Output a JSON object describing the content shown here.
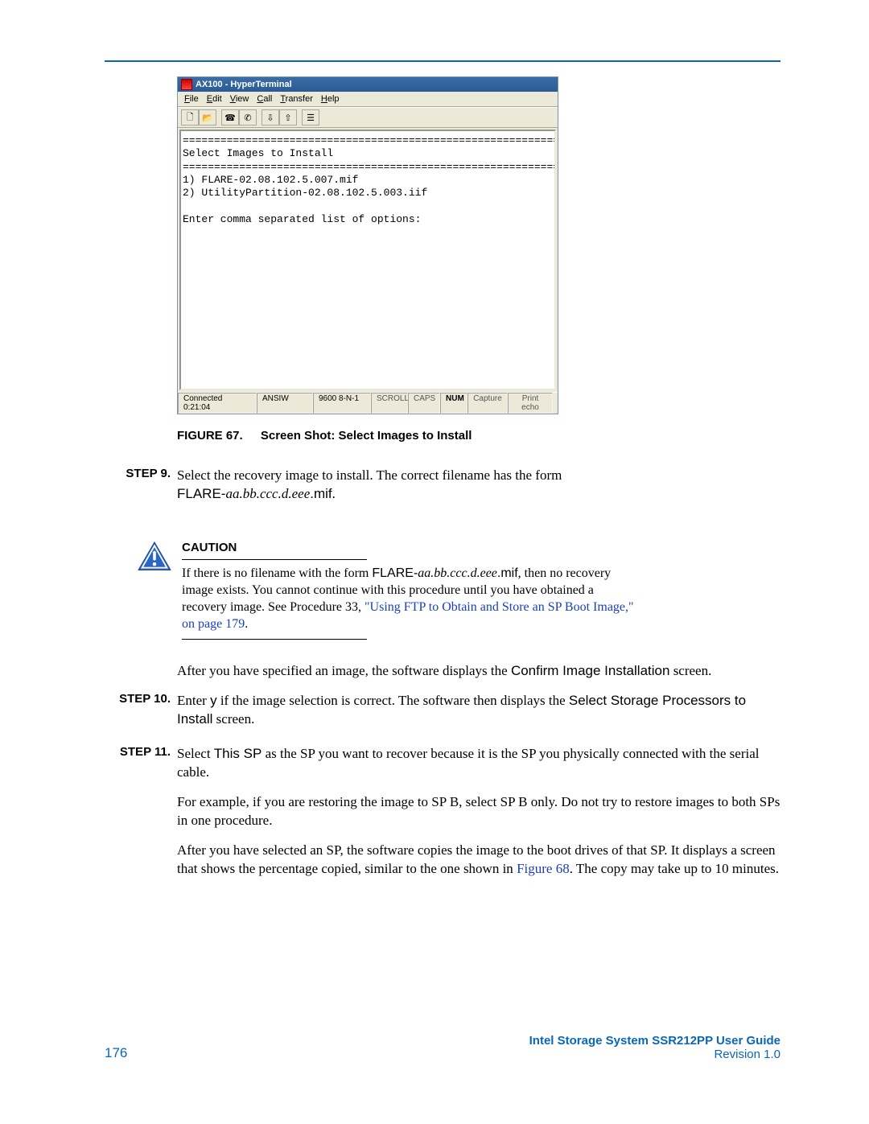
{
  "rule_color": "#0a66b7",
  "hyperterm": {
    "title": "AX100 - HyperTerminal",
    "menu": {
      "file": "File",
      "edit": "Edit",
      "view": "View",
      "call": "Call",
      "transfer": "Transfer",
      "help": "Help"
    },
    "toolbar_icons": [
      "new-file-icon",
      "open-file-icon",
      "connect-icon",
      "disconnect-icon",
      "send-icon",
      "receive-icon",
      "properties-icon"
    ],
    "terminal_text": "=============================================================\nSelect Images to Install\n=============================================================\n1) FLARE-02.08.102.5.007.mif\n2) UtilityPartition-02.08.102.5.003.iif\n\nEnter comma separated list of options:",
    "status": {
      "connected": "Connected 0:21:04",
      "emulation": "ANSIW",
      "port": "9600 8-N-1",
      "scroll": "SCROLL",
      "caps": "CAPS",
      "num": "NUM",
      "capture": "Capture",
      "printecho": "Print echo"
    }
  },
  "figure": {
    "label": "FIGURE 67.",
    "caption": "Screen Shot: Select Images to Install"
  },
  "steps": {
    "s9_label": "STEP 9.",
    "s9_line1": "Select the recovery image to install. The correct filename has the form",
    "s9_flare_prefix": "FLARE-",
    "s9_flare_var": "aa.bb.ccc.d.eee",
    "s9_flare_suffix": ".mif",
    "s9_period": ".",
    "s10_label": "STEP 10.",
    "s10_pre": "Enter ",
    "s10_y": "y",
    "s10_mid": " if the image selection is correct. The software then displays the ",
    "s10_screen": "Select Storage Processors to Install",
    "s10_post": " screen.",
    "s11_label": "STEP 11.",
    "s11_p1a": "Select ",
    "s11_thissp": "This SP",
    "s11_p1b": " as the SP you want to recover because it is the SP you physically connected with the serial cable.",
    "s11_p2": "For example, if you are restoring the image to SP B, select SP B only. Do not try to restore images to both SPs in one procedure.",
    "s11_p3a": "After you have selected an SP, the software copies the image to the boot drives of that SP. It displays a screen that shows the percentage copied, similar to the one shown in ",
    "s11_fig68": "Figure 68",
    "s11_p3b": ". The copy may take up to 10 minutes."
  },
  "caution": {
    "head": "CAUTION",
    "pre": "If there is no filename with the form ",
    "flare_prefix": "FLARE-",
    "flare_var": "aa.bb.ccc.d.eee",
    "flare_suffix": ".mif",
    "mid": ", then no recovery image exists. You cannot continue with this procedure until you have obtained a recovery image. See Procedure 33, ",
    "link": "\"Using FTP to Obtain and Store an SP Boot Image,\" on page 179",
    "end": "."
  },
  "after_caution": {
    "pre": "After you have specified an image, the software displays the ",
    "screen": "Confirm Image Installation",
    "post": " screen."
  },
  "footer": {
    "page": "176",
    "guide": "Intel Storage System SSR212PP User Guide",
    "revision": "Revision 1.0"
  }
}
